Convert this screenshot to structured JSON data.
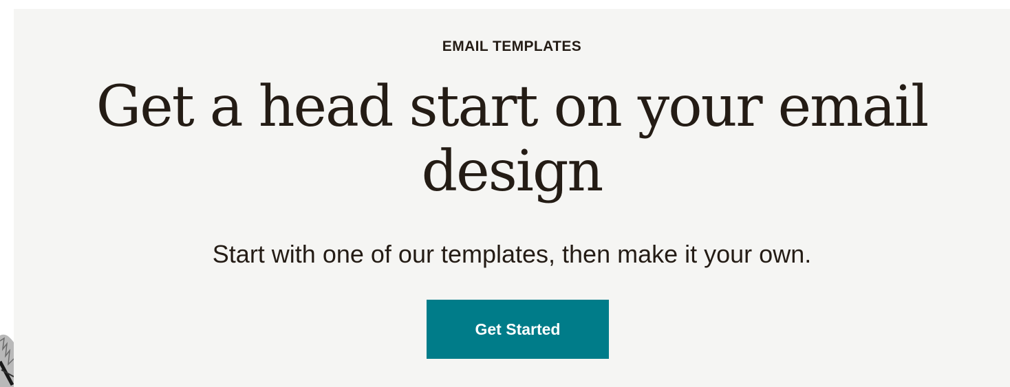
{
  "hero": {
    "eyebrow": "EMAIL TEMPLATES",
    "headline": "Get a head start on your email design",
    "subheadline": "Start with one of our templates, then make it your own.",
    "cta_label": "Get Started"
  },
  "colors": {
    "background": "#f5f5f3",
    "text": "#241c15",
    "button": "#007c89",
    "button_text": "#ffffff"
  }
}
